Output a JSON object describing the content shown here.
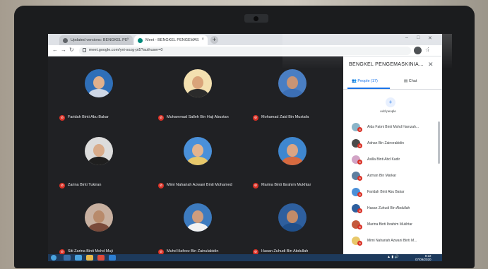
{
  "browser": {
    "tabs": [
      {
        "title": "Updated versions: BENGKEL PE"
      },
      {
        "title": "Meet - BENGKEL PENGEMAS"
      }
    ],
    "new_tab_label": "+",
    "url": "meet.google.com/yni-sozg-pt5?authuser=0"
  },
  "meet": {
    "tiles": [
      {
        "name": "Faridah Binti Abu Bakar",
        "color": "#4a90d9"
      },
      {
        "name": "Muhammad Salleh Bin Haji Abustan",
        "color": "#2b2b2b"
      },
      {
        "name": "Mohamad Zaid Bin Mustafa",
        "color": "#3c6fb5"
      },
      {
        "name": "Zarina Binti Tukiran",
        "color": "#1f1f1f"
      },
      {
        "name": "Mimi Nahariah Azwani Binti Mohamed",
        "color": "#e8c86a"
      },
      {
        "name": "Marina Binti Ibrahim Mukhtar",
        "color": "#c45a3c"
      },
      {
        "name": "Siti Zarina Binti Mohd Muji",
        "color": "#7a4a3a"
      },
      {
        "name": "Muhd Hafeez Bin Zainulabidin",
        "color": "#3d7bbf"
      },
      {
        "name": "Hasan Zuhudi Bin Abdullah",
        "color": "#2e5f9e"
      }
    ]
  },
  "panel": {
    "title": "BENGKEL PENGEMASKINIA...",
    "close_label": "✕",
    "people_tab": "People (17)",
    "chat_tab": "Chat",
    "add_people": "Add people",
    "participants": [
      {
        "name": "Aida Fatmi Binti Mohd Hamzah...",
        "color": "#8ab4c8"
      },
      {
        "name": "Adnan Bin Zainorabidin",
        "color": "#4b4b4b"
      },
      {
        "name": "Asilla Binti Abd Kadir",
        "color": "#d2a4c6"
      },
      {
        "name": "Azman Bin Markar",
        "color": "#5d7fa0"
      },
      {
        "name": "Faridah Binti Abu Bakar",
        "color": "#4a90d9"
      },
      {
        "name": "Hasan Zuhudi Bin Abdullah",
        "color": "#2e5f9e"
      },
      {
        "name": "Marina Binti Ibrahim Mukhtar",
        "color": "#c45a3c"
      },
      {
        "name": "Mimi Nahariah Azwani Binti M...",
        "color": "#e8c86a"
      }
    ]
  },
  "taskbar": {
    "time": "9:22",
    "date": "07/09/2020"
  }
}
